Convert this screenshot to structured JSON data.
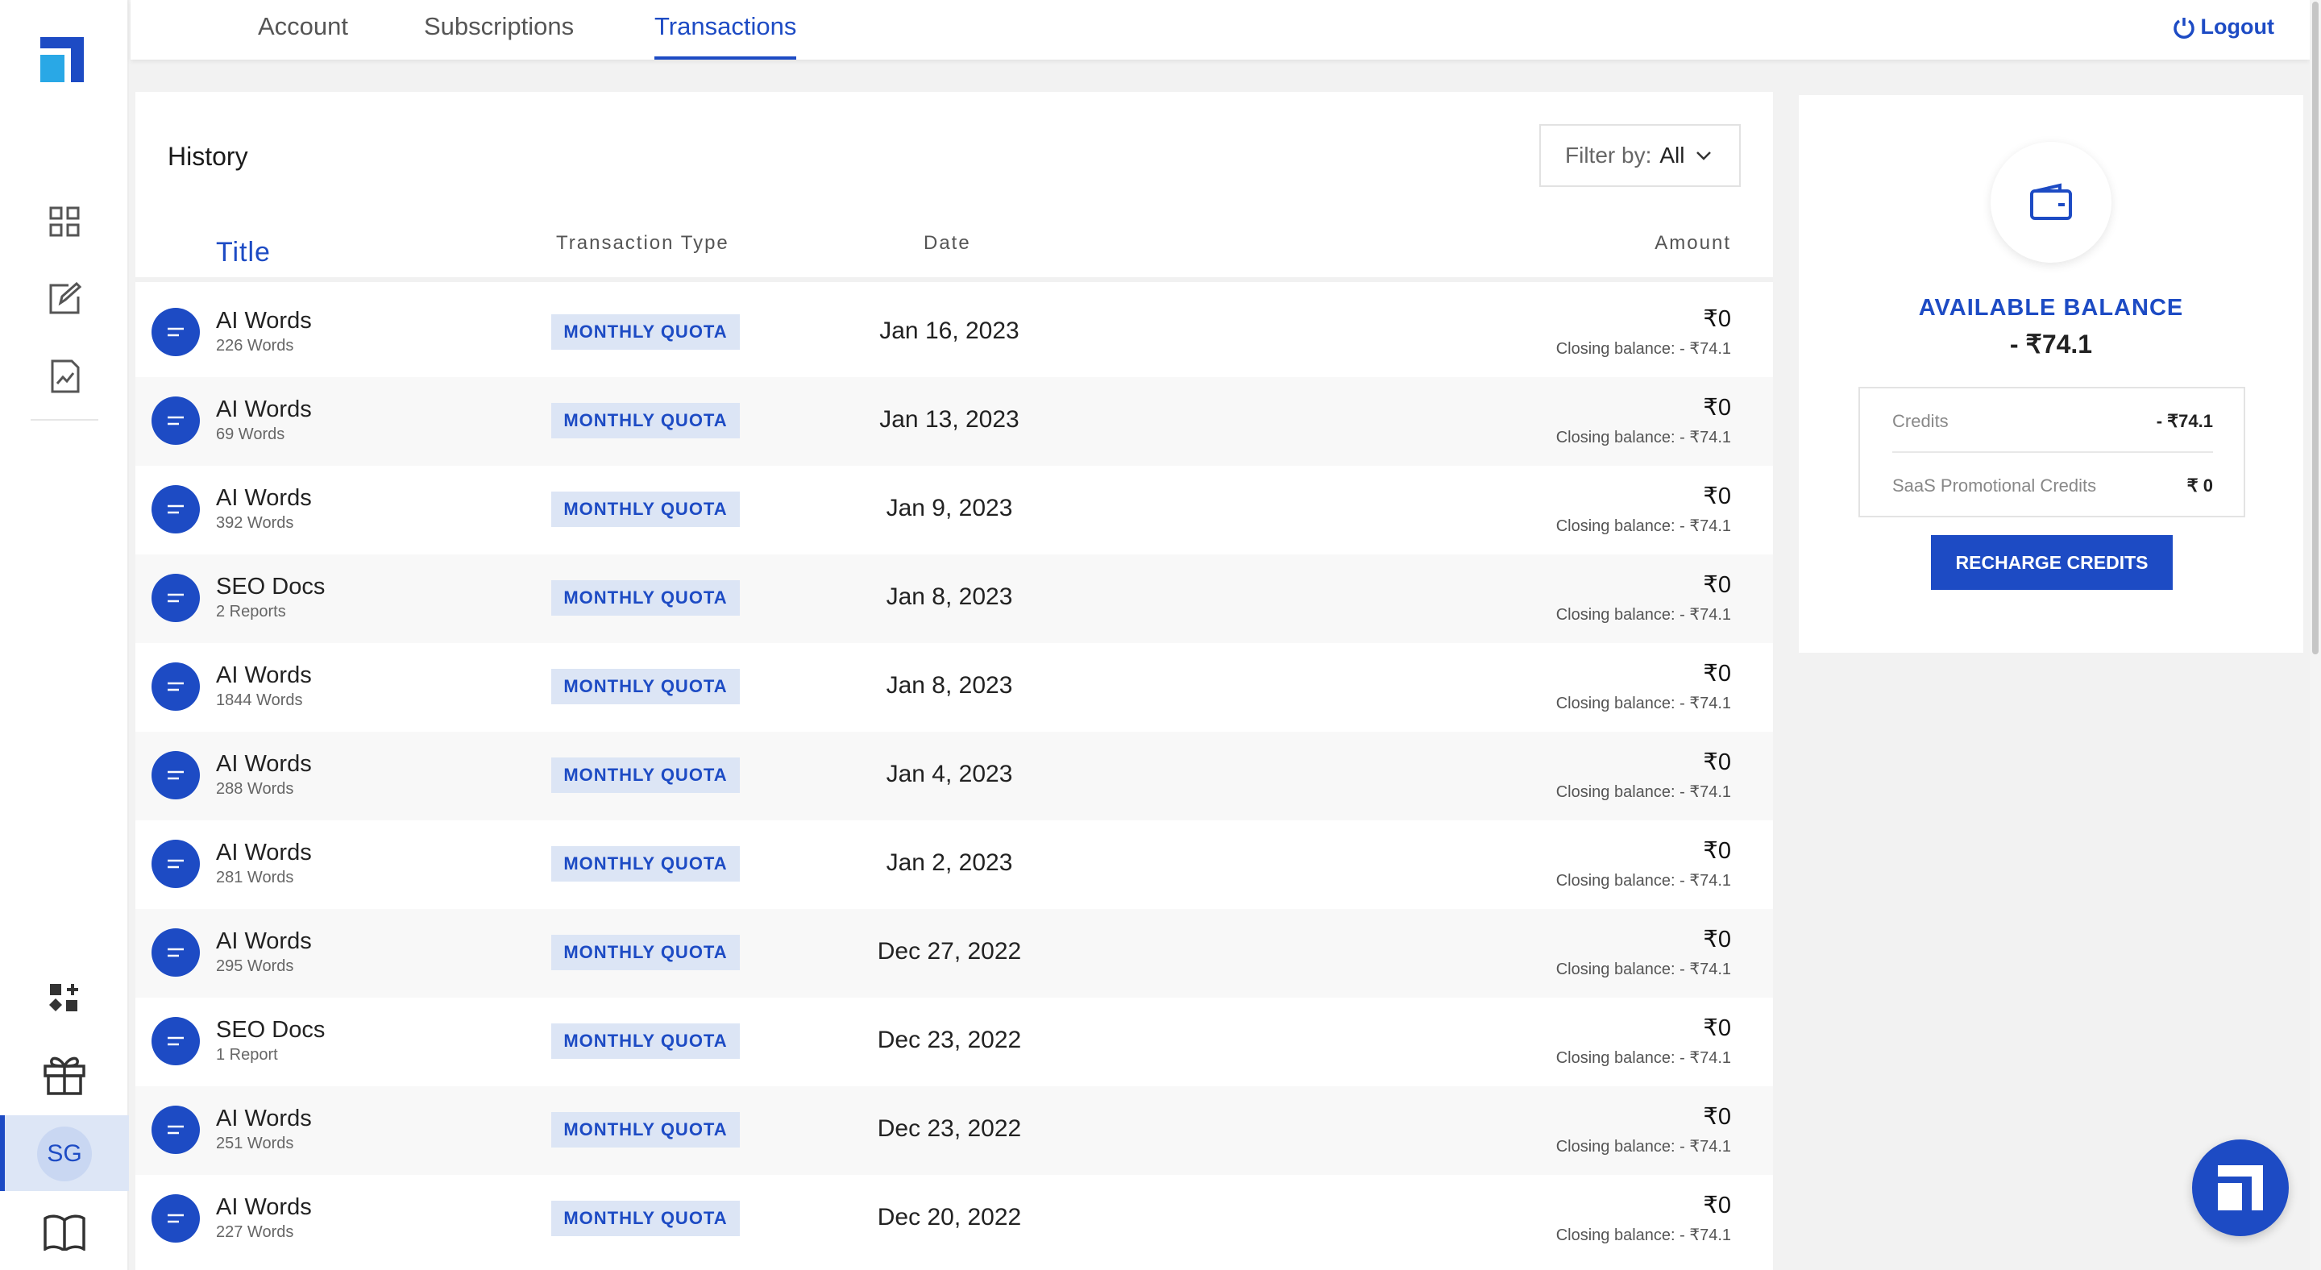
{
  "nav": {
    "tabs": [
      {
        "label": "Account"
      },
      {
        "label": "Subscriptions"
      },
      {
        "label": "Transactions",
        "active": true
      }
    ],
    "logout_label": "Logout"
  },
  "sidebar": {
    "icons": [
      "dashboard-grid-icon",
      "edit-document-icon",
      "analytics-chart-icon",
      "add-widget-icon",
      "gift-icon",
      "book-icon"
    ],
    "avatar_initials": "SG"
  },
  "history": {
    "title": "History",
    "filter_label": "Filter by:",
    "filter_value": "All",
    "columns": {
      "title": "Title",
      "type": "Transaction Type",
      "date": "Date",
      "amount": "Amount"
    },
    "rows": [
      {
        "title": "AI Words",
        "sub": "226 Words",
        "type": "MONTHLY QUOTA",
        "date": "Jan 16, 2023",
        "amount": "₹0",
        "closing": "Closing balance: - ₹74.1"
      },
      {
        "title": "AI Words",
        "sub": "69 Words",
        "type": "MONTHLY QUOTA",
        "date": "Jan 13, 2023",
        "amount": "₹0",
        "closing": "Closing balance: - ₹74.1"
      },
      {
        "title": "AI Words",
        "sub": "392 Words",
        "type": "MONTHLY QUOTA",
        "date": "Jan 9, 2023",
        "amount": "₹0",
        "closing": "Closing balance: - ₹74.1"
      },
      {
        "title": "SEO Docs",
        "sub": "2 Reports",
        "type": "MONTHLY QUOTA",
        "date": "Jan 8, 2023",
        "amount": "₹0",
        "closing": "Closing balance: - ₹74.1"
      },
      {
        "title": "AI Words",
        "sub": "1844 Words",
        "type": "MONTHLY QUOTA",
        "date": "Jan 8, 2023",
        "amount": "₹0",
        "closing": "Closing balance: - ₹74.1"
      },
      {
        "title": "AI Words",
        "sub": "288 Words",
        "type": "MONTHLY QUOTA",
        "date": "Jan 4, 2023",
        "amount": "₹0",
        "closing": "Closing balance: - ₹74.1"
      },
      {
        "title": "AI Words",
        "sub": "281 Words",
        "type": "MONTHLY QUOTA",
        "date": "Jan 2, 2023",
        "amount": "₹0",
        "closing": "Closing balance: - ₹74.1"
      },
      {
        "title": "AI Words",
        "sub": "295 Words",
        "type": "MONTHLY QUOTA",
        "date": "Dec 27, 2022",
        "amount": "₹0",
        "closing": "Closing balance: - ₹74.1"
      },
      {
        "title": "SEO Docs",
        "sub": "1 Report",
        "type": "MONTHLY QUOTA",
        "date": "Dec 23, 2022",
        "amount": "₹0",
        "closing": "Closing balance: - ₹74.1"
      },
      {
        "title": "AI Words",
        "sub": "251 Words",
        "type": "MONTHLY QUOTA",
        "date": "Dec 23, 2022",
        "amount": "₹0",
        "closing": "Closing balance: - ₹74.1"
      },
      {
        "title": "AI Words",
        "sub": "227 Words",
        "type": "MONTHLY QUOTA",
        "date": "Dec 20, 2022",
        "amount": "₹0",
        "closing": "Closing balance: - ₹74.1"
      }
    ]
  },
  "balance": {
    "label": "AVAILABLE BALANCE",
    "value": "- ₹74.1",
    "credits_label": "Credits",
    "credits_value": "- ₹74.1",
    "promo_label": "SaaS Promotional Credits",
    "promo_value": "₹ 0",
    "recharge_label": "RECHARGE CREDITS"
  },
  "colors": {
    "accent": "#1d4bc4",
    "badge_bg": "#dce5f5",
    "page_bg": "#f2f2f2"
  }
}
